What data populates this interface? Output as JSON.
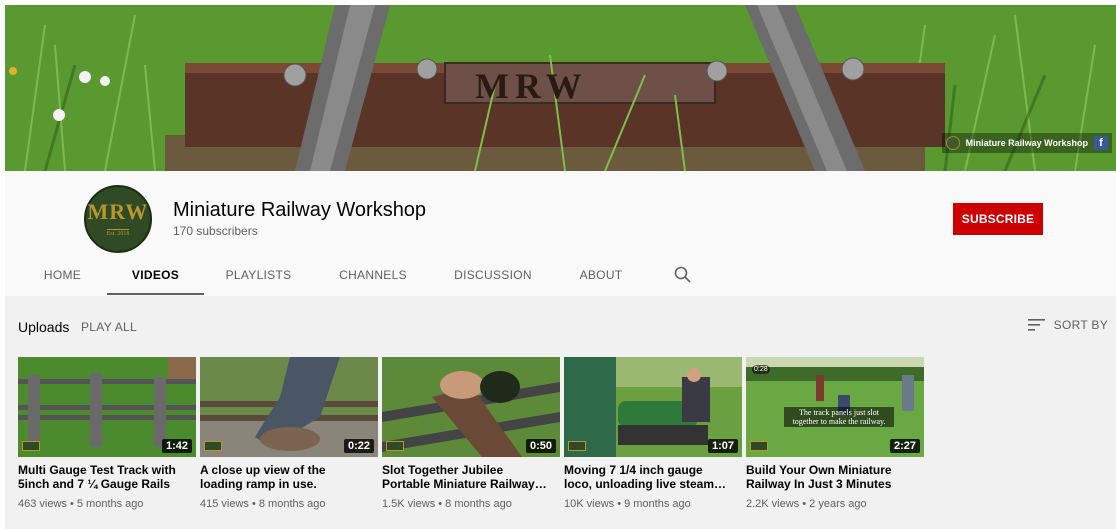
{
  "banner": {
    "logo_text": "MRW",
    "link_text": "Miniature Railway Workshop",
    "fb_glyph": "f"
  },
  "channel": {
    "avatar_text": "MRW",
    "avatar_est": "Est. 2018",
    "name": "Miniature Railway Workshop",
    "subscribers": "170 subscribers",
    "subscribe_label": "SUBSCRIBE"
  },
  "tabs": [
    {
      "label": "HOME",
      "active": false
    },
    {
      "label": "VIDEOS",
      "active": true
    },
    {
      "label": "PLAYLISTS",
      "active": false
    },
    {
      "label": "CHANNELS",
      "active": false
    },
    {
      "label": "DISCUSSION",
      "active": false
    },
    {
      "label": "ABOUT",
      "active": false
    }
  ],
  "section": {
    "title": "Uploads",
    "play_all": "PLAY ALL",
    "sort_by": "SORT BY"
  },
  "videos": [
    {
      "title": "Multi Gauge Test Track with 5inch and 7 ¼ Gauge Rails",
      "duration": "1:42",
      "meta": "463 views • 5 months ago"
    },
    {
      "title": "A close up view of the loading ramp in use.",
      "duration": "0:22",
      "meta": "415 views • 8 months ago"
    },
    {
      "title": "Slot Together Jubilee Portable Miniature Railway…",
      "duration": "0:50",
      "meta": "1.5K views • 8 months ago"
    },
    {
      "title": "Moving 7 1/4 inch gauge loco, unloading live steam…",
      "duration": "1:07",
      "meta": "10K views • 9 months ago"
    },
    {
      "title": "Build Your Own Miniature Railway In Just 3 Minutes",
      "duration": "2:27",
      "meta": "2.2K views • 2 years ago",
      "overlay": "The track panels just slot together to make the railway.",
      "badge": "0:28"
    }
  ],
  "colors": {
    "subscribe": "#cc0000",
    "header_bg": "#f9f9f9",
    "main_bg": "#f1f1f1",
    "brand_gold": "#b8962e",
    "brand_green": "#2f4a24"
  }
}
